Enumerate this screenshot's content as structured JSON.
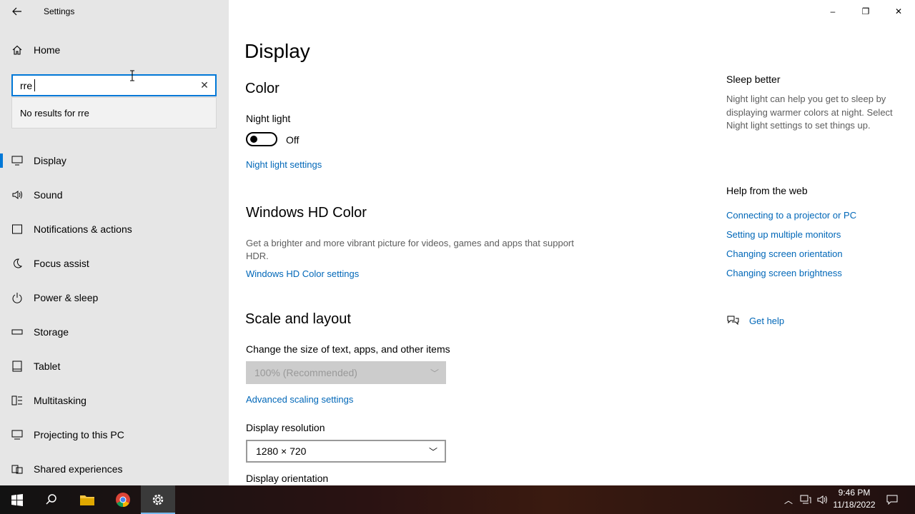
{
  "window": {
    "title": "Settings",
    "back_icon": "back-arrow-icon",
    "controls": {
      "minimize": "–",
      "restore": "❐",
      "close": "✕"
    }
  },
  "sidebar": {
    "home_label": "Home",
    "search": {
      "value": "rre",
      "clear_icon": "clear-x-icon"
    },
    "suggestion": "No results for rre",
    "items": [
      {
        "label": "Display",
        "icon": "monitor-icon",
        "active": true
      },
      {
        "label": "Sound",
        "icon": "speaker-icon"
      },
      {
        "label": "Notifications & actions",
        "icon": "notification-icon"
      },
      {
        "label": "Focus assist",
        "icon": "moon-icon"
      },
      {
        "label": "Power & sleep",
        "icon": "power-icon"
      },
      {
        "label": "Storage",
        "icon": "storage-icon"
      },
      {
        "label": "Tablet",
        "icon": "tablet-icon"
      },
      {
        "label": "Multitasking",
        "icon": "multitasking-icon"
      },
      {
        "label": "Projecting to this PC",
        "icon": "projecting-icon"
      },
      {
        "label": "Shared experiences",
        "icon": "shared-experiences-icon"
      }
    ]
  },
  "main": {
    "title": "Display",
    "color": {
      "heading": "Color",
      "night_light_label": "Night light",
      "night_light_state": "Off",
      "night_light_settings_link": "Night light settings"
    },
    "hd_color": {
      "heading": "Windows HD Color",
      "description": "Get a brighter and more vibrant picture for videos, games and apps that support HDR.",
      "link": "Windows HD Color settings"
    },
    "scale": {
      "heading": "Scale and layout",
      "size_label": "Change the size of text, apps, and other items",
      "size_value": "100% (Recommended)",
      "advanced_link": "Advanced scaling settings",
      "resolution_label": "Display resolution",
      "resolution_value": "1280 × 720",
      "orientation_label": "Display orientation"
    }
  },
  "aside": {
    "sleep_heading": "Sleep better",
    "sleep_text": "Night light can help you get to sleep by displaying warmer colors at night. Select Night light settings to set things up.",
    "help_heading": "Help from the web",
    "help_links": [
      "Connecting to a projector or PC",
      "Setting up multiple monitors",
      "Changing screen orientation",
      "Changing screen brightness"
    ],
    "get_help": "Get help"
  },
  "taskbar": {
    "apps": [
      "start-icon",
      "search-icon",
      "file-explorer-icon",
      "chrome-icon",
      "settings-gear-icon"
    ],
    "time": "9:46 PM",
    "date": "11/18/2022"
  },
  "colors": {
    "accent": "#0078d7",
    "link": "#0067b8",
    "sidebar_bg": "#e6e6e6"
  }
}
